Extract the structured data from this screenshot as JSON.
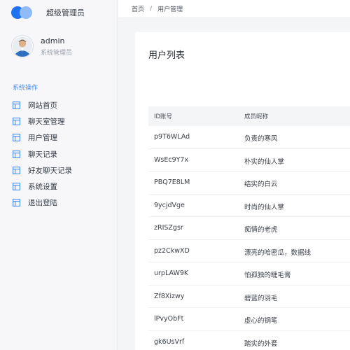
{
  "brand": {
    "title": "超级管理员"
  },
  "profile": {
    "name": "admin",
    "role": "系统管理员"
  },
  "sidebar": {
    "section_title": "系统操作",
    "items": [
      {
        "label": "网站首页",
        "icon": "layout-icon"
      },
      {
        "label": "聊天室管理",
        "icon": "layout-icon"
      },
      {
        "label": "用户管理",
        "icon": "layout-icon"
      },
      {
        "label": "聊天记录",
        "icon": "layout-icon"
      },
      {
        "label": "好友聊天记录",
        "icon": "layout-icon"
      },
      {
        "label": "系统设置",
        "icon": "layout-icon"
      },
      {
        "label": "退出登陆",
        "icon": "layout-icon"
      }
    ]
  },
  "breadcrumb": {
    "home": "首页",
    "separator": "/",
    "current": "用户管理"
  },
  "main": {
    "title": "用户列表",
    "columns": {
      "id": "ID账号",
      "nickname": "成员昵称"
    },
    "rows": [
      {
        "id": "p9T6WLAd",
        "nickname": "负责的寒风"
      },
      {
        "id": "WsEc9Y7x",
        "nickname": "朴实的仙人掌"
      },
      {
        "id": "PBQ7E8LM",
        "nickname": "结实的白云"
      },
      {
        "id": "9ycjdVge",
        "nickname": "时尚的仙人掌"
      },
      {
        "id": "zRISZgsr",
        "nickname": "痴情的老虎"
      },
      {
        "id": "pz2CkwXD",
        "nickname": "漂亮的哈密瓜，数据线"
      },
      {
        "id": "urpLAW9K",
        "nickname": "怕孤独的睫毛膏"
      },
      {
        "id": "Zf8Xizwy",
        "nickname": "碧蓝的羽毛"
      },
      {
        "id": "lPvyObFt",
        "nickname": "虚心的钢笔"
      },
      {
        "id": "gk6UsVrf",
        "nickname": "踏实的外套"
      }
    ]
  },
  "colors": {
    "accent": "#1e73f0",
    "accent_light": "#8fbcf8",
    "section_title": "#4a8ef0"
  }
}
